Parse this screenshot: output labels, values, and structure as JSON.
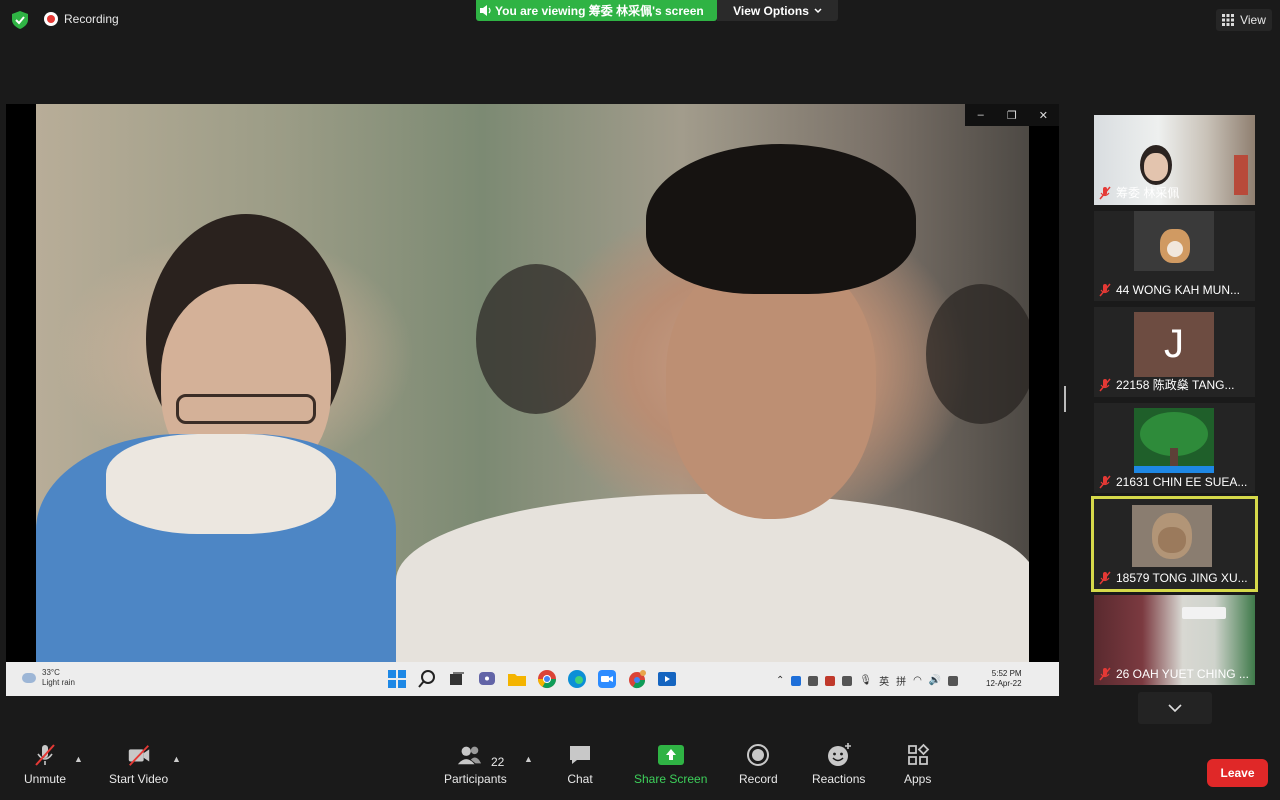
{
  "top_bar": {
    "recording_label": "Recording",
    "viewing_banner": "You are viewing 筹委 林采佩's screen",
    "view_options_label": "View Options",
    "view_label": "View"
  },
  "shared_screen": {
    "window_controls": [
      "–",
      "❐",
      "✕"
    ],
    "taskbar": {
      "weather_temp": "33°C",
      "weather_desc": "Light rain",
      "tray_lang1": "英",
      "tray_lang2": "拼",
      "clock_time": "5:52 PM",
      "clock_date": "12-Apr-22"
    }
  },
  "participants_panel": {
    "tiles": [
      {
        "name": "筹委 林采佩",
        "avatar": "video-woman"
      },
      {
        "name": "44 WONG KAH MUN...",
        "avatar": "video-corgi"
      },
      {
        "name": "22158 陈政燊 TANG...",
        "avatar": "letter",
        "letter": "J"
      },
      {
        "name": "21631 CHIN EE SUEA...",
        "avatar": "video-tree"
      },
      {
        "name": "18579 TONG JING XU...",
        "avatar": "video-cat",
        "active_speaker": true
      },
      {
        "name": "26 OAH YUET CHING ...",
        "avatar": "video-room"
      }
    ]
  },
  "toolbar": {
    "unmute_label": "Unmute",
    "start_video_label": "Start Video",
    "participants_label": "Participants",
    "participants_count": "22",
    "chat_label": "Chat",
    "share_screen_label": "Share Screen",
    "record_label": "Record",
    "reactions_label": "Reactions",
    "apps_label": "Apps",
    "leave_label": "Leave"
  },
  "colors": {
    "accent_green": "#2fb344",
    "share_green": "#3dcf5a",
    "leave_red": "#e02828",
    "active_speaker_border": "#d6d94a",
    "mic_off_red": "#e53935"
  }
}
